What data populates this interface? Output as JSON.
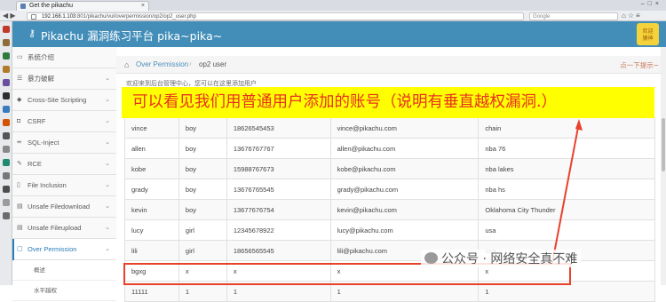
{
  "browser": {
    "tab_title": "Get the pikachu",
    "url_host": "192.168.1.103",
    "url_rest": ":801/pikachu/vul/overpermission/op2/op2_user.php",
    "search_placeholder": "Google"
  },
  "header": {
    "title": "Pikachu 漏洞练习平台 pika~pika~",
    "avatar_line1": "欢迎",
    "avatar_line2": "猿神"
  },
  "menu": {
    "items": [
      {
        "label": "系统介绍",
        "icon": "desktop-icon"
      },
      {
        "label": "暴力破解",
        "icon": "list-icon"
      },
      {
        "label": "Cross-Site Scripting",
        "icon": "tag-icon"
      },
      {
        "label": "CSRF",
        "icon": "shield-icon"
      },
      {
        "label": "SQL-Inject",
        "icon": "fork-icon"
      },
      {
        "label": "RCE",
        "icon": "pencil-icon"
      },
      {
        "label": "File Inclusion",
        "icon": "file-icon"
      },
      {
        "label": "Unsafe Filedownload",
        "icon": "download-icon"
      },
      {
        "label": "Unsafe Fileupload",
        "icon": "upload-icon"
      },
      {
        "label": "Over Permission",
        "icon": "lock-icon"
      }
    ],
    "sub_items": [
      "概述",
      "水平越权"
    ]
  },
  "breadcrumb": {
    "parent": "Over Permission",
    "current": "op2 user",
    "tip": "点一下提示~"
  },
  "intro_text": "欢迎来到后台管理中心，您可以在这里添加用户",
  "banner": "可以看见我们用普通用户添加的账号（说明有垂直越权漏洞.）",
  "table": {
    "rows": [
      [
        "vince",
        "boy",
        "18626545453",
        "vince@pikachu.com",
        "chain"
      ],
      [
        "allen",
        "boy",
        "13676767767",
        "allen@pikachu.com",
        "nba 76"
      ],
      [
        "kobe",
        "boy",
        "15988767673",
        "kobe@pikachu.com",
        "nba lakes"
      ],
      [
        "grady",
        "boy",
        "13676765545",
        "grady@pikachu.com",
        "nba hs"
      ],
      [
        "kevin",
        "boy",
        "13677676754",
        "kevin@pikachu.com",
        "Oklahoma City Thunder"
      ],
      [
        "lucy",
        "girl",
        "12345678922",
        "lucy@pikachu.com",
        "usa"
      ],
      [
        "lili",
        "girl",
        "18656565545",
        "lili@pikachu.com",
        "usa"
      ],
      [
        "bgxg",
        "x",
        "x",
        "x",
        "x"
      ],
      [
        "11111",
        "1",
        "1",
        "1",
        "1"
      ]
    ]
  },
  "watermark": "公众号 · 网络安全真不难",
  "colors": {
    "header_blue": "#438eb9",
    "banner_yellow": "#ffff00",
    "banner_text": "#e8301f",
    "highlight_red": "#e8412c"
  }
}
